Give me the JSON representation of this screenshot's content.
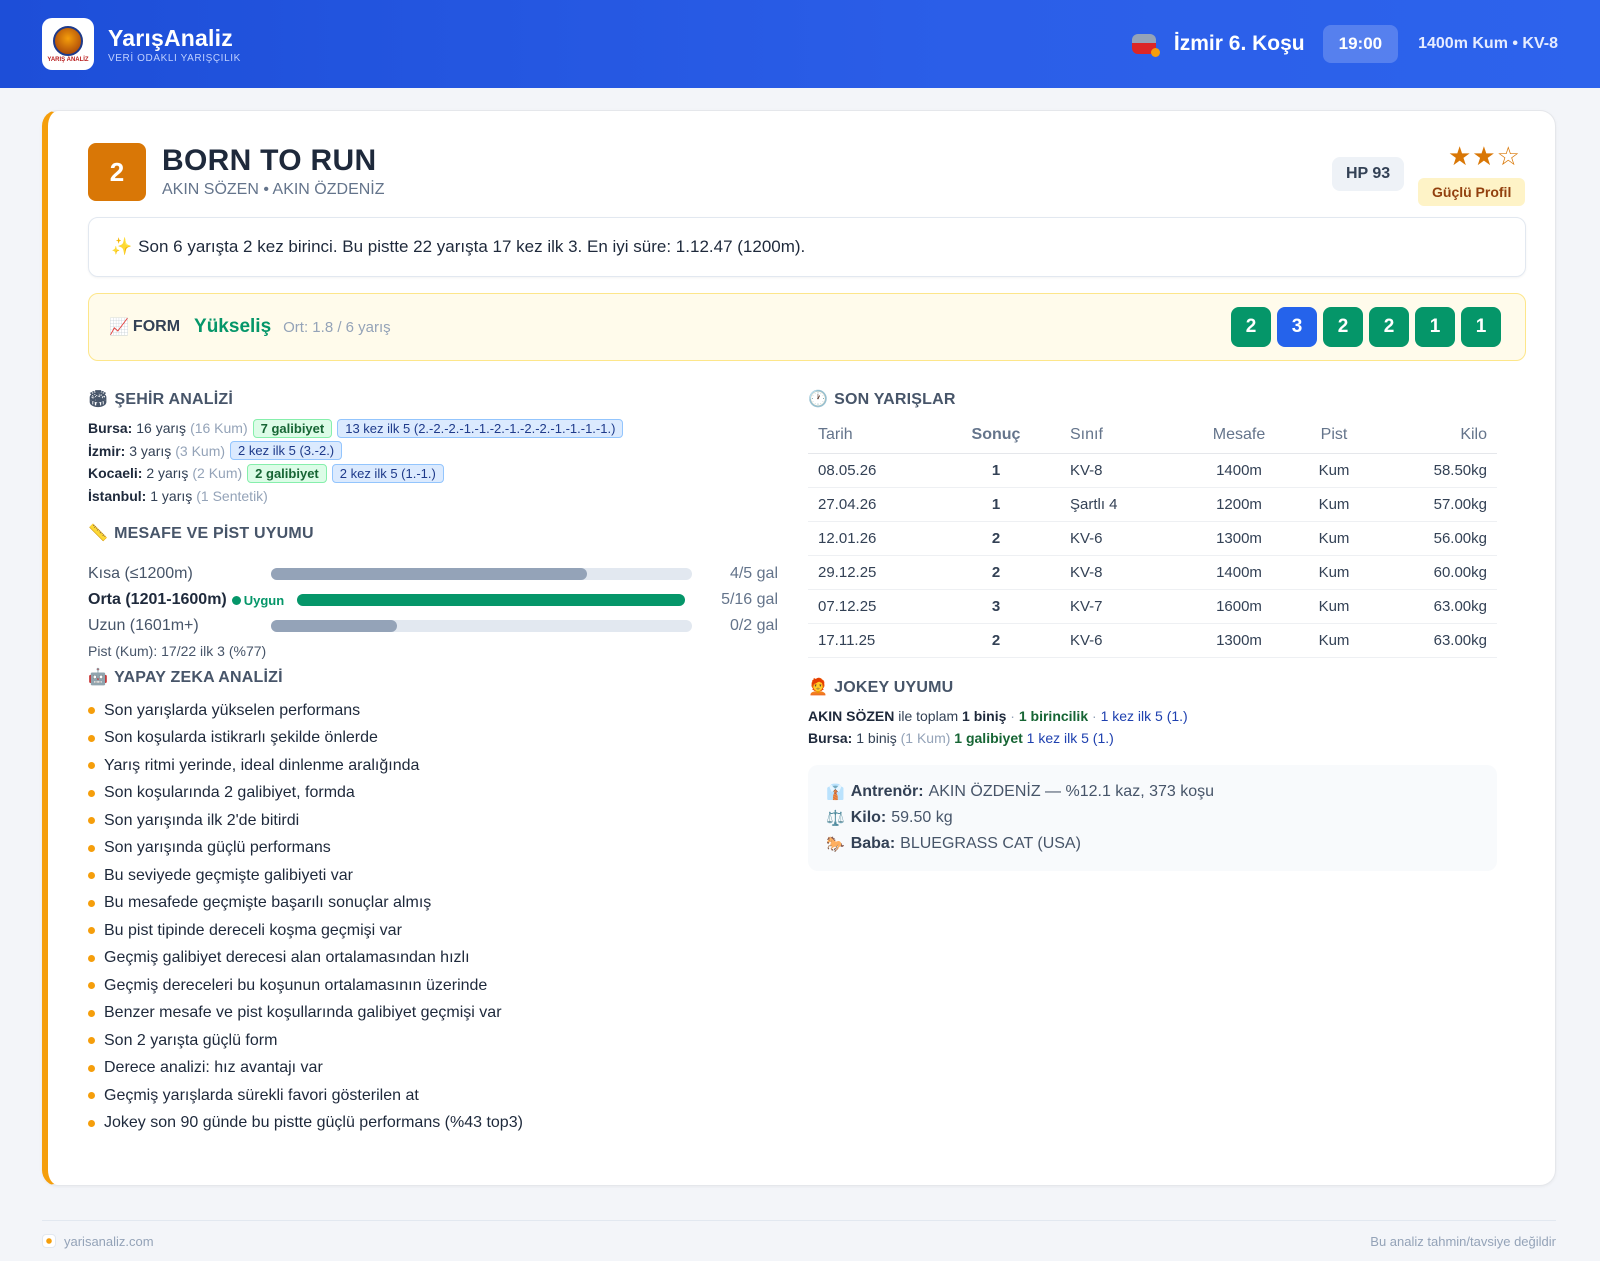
{
  "header": {
    "brand_name": "YarışAnaliz",
    "brand_tagline": "VERİ ODAKLI YARIŞÇILIK",
    "logo_text": "YARIŞ ANALİZ",
    "race_title": "İzmir 6. Koşu",
    "race_time": "19:00",
    "race_info": "1400m Kum • KV-8"
  },
  "horse": {
    "number": "2",
    "name": "BORN TO RUN",
    "subtitle": "AKIN SÖZEN • AKIN ÖZDENİZ",
    "hp": "HP 93",
    "stars": "★★☆",
    "profile_badge": "Güçlü Profil",
    "rating": 2
  },
  "summary": {
    "icon": "✨",
    "text": "Son 6 yarışta 2 kez birinci. Bu pistte 22 yarışta 17 kez ilk 3. En iyi süre: 1.12.47 (1200m)."
  },
  "form": {
    "icon": "📈",
    "label": "FORM",
    "trend": "Yükseliş",
    "avg": "Ort: 1.8 / 6 yarış",
    "results": [
      "2",
      "3",
      "2",
      "2",
      "1",
      "1"
    ]
  },
  "city_analysis": {
    "icon": "🏟",
    "title": "ŞEHİR ANALİZİ",
    "rows": [
      {
        "city": "Bursa:",
        "races": "16 yarış",
        "surface": "(16 Kum)",
        "wins": "7 galibiyet",
        "top5": "13 kez ilk 5 (2.-2.-2.-1.-1.-2.-1.-2.-2.-1.-1.-1.-1.)"
      },
      {
        "city": "İzmir:",
        "races": "3 yarış",
        "surface": "(3 Kum)",
        "wins": "",
        "top5": "2 kez ilk 5 (3.-2.)"
      },
      {
        "city": "Kocaeli:",
        "races": "2 yarış",
        "surface": "(2 Kum)",
        "wins": "2 galibiyet",
        "top5": "2 kez ilk 5 (1.-1.)"
      },
      {
        "city": "İstanbul:",
        "races": "1 yarış",
        "surface": "(1 Sentetik)",
        "wins": "",
        "top5": ""
      }
    ]
  },
  "distance": {
    "icon": "📏",
    "title": "MESAFE VE PİST UYUMU",
    "rows": [
      {
        "label": "Kısa (≤1200m)",
        "value": "4/5 gal",
        "fill": 0.75
      },
      {
        "label": "Orta (1201-1600m)",
        "badge": "Uygun",
        "value": "5/16 gal",
        "fill": 1.0
      },
      {
        "label": "Uzun (1601m+)",
        "value": "0/2 gal",
        "fill": 0.3
      }
    ],
    "pist": "Pist (Kum): 17/22 ilk 3 (%77)"
  },
  "ai": {
    "icon": "🤖",
    "title": "YAPAY ZEKA ANALİZİ",
    "items": [
      "Son yarışlarda yükselen performans",
      "Son koşularda istikrarlı şekilde önlerde",
      "Yarış ritmi yerinde, ideal dinlenme aralığında",
      "Son koşularında 2 galibiyet, formda",
      "Son yarışında ilk 2'de bitirdi",
      "Son yarışında güçlü performans",
      "Bu seviyede geçmişte galibiyeti var",
      "Bu mesafede geçmişte başarılı sonuçlar almış",
      "Bu pist tipinde dereceli koşma geçmişi var",
      "Geçmiş galibiyet derecesi alan ortalamasından hızlı",
      "Geçmiş dereceleri bu koşunun ortalamasının üzerinde",
      "Benzer mesafe ve pist koşullarında galibiyet geçmişi var",
      "Son 2 yarışta güçlü form",
      "Derece analizi: hız avantajı var",
      "Geçmiş yarışlarda sürekli favori gösterilen at",
      "Jokey son 90 günde bu pistte güçlü performans (%43 top3)"
    ]
  },
  "recent": {
    "icon": "🕐",
    "title": "SON YARIŞLAR",
    "columns": [
      "Tarih",
      "Sonuç",
      "Sınıf",
      "Mesafe",
      "Pist",
      "Kilo"
    ],
    "rows": [
      [
        "08.05.26",
        "1",
        "KV-8",
        "1400m",
        "Kum",
        "58.50kg"
      ],
      [
        "27.04.26",
        "1",
        "Şartlı 4",
        "1200m",
        "Kum",
        "57.00kg"
      ],
      [
        "12.01.26",
        "2",
        "KV-6",
        "1300m",
        "Kum",
        "56.00kg"
      ],
      [
        "29.12.25",
        "2",
        "KV-8",
        "1400m",
        "Kum",
        "60.00kg"
      ],
      [
        "07.12.25",
        "3",
        "KV-7",
        "1600m",
        "Kum",
        "63.00kg"
      ],
      [
        "17.11.25",
        "2",
        "KV-6",
        "1300m",
        "Kum",
        "63.00kg"
      ]
    ]
  },
  "jockey": {
    "icon": "🧑‍🦰",
    "title": "JOKEY UYUMU",
    "name": "AKIN SÖZEN",
    "text1": "ile toplam",
    "rides": "1 biniş",
    "sep": "·",
    "wins": "1 birincilik",
    "top5": "1 kez ilk 5 (1.)",
    "city_label": "Bursa:",
    "city_rides": "1 biniş",
    "city_surface": "(1 Kum)",
    "city_wins": "1 galibiyet",
    "city_top5": "1 kez ilk 5 (1.)"
  },
  "info": {
    "trainer_icon": "👔",
    "trainer_label": "Antrenör:",
    "trainer_value": "AKIN ÖZDENİZ — %12.1 kaz, 373 koşu",
    "weight_icon": "⚖️",
    "weight_label": "Kilo:",
    "weight_value": "59.50 kg",
    "sire_icon": "🐎",
    "sire_label": "Baba:",
    "sire_value": "BLUEGRASS CAT (USA)"
  },
  "footer": {
    "site": "yarisanaliz.com",
    "disclaimer": "Bu analiz tahmin/tavsiye değildir"
  },
  "colors": {
    "header": "#1d4ed8",
    "accent": "#f59e0b",
    "win_green": "#059669",
    "place_blue": "#2563eb"
  }
}
